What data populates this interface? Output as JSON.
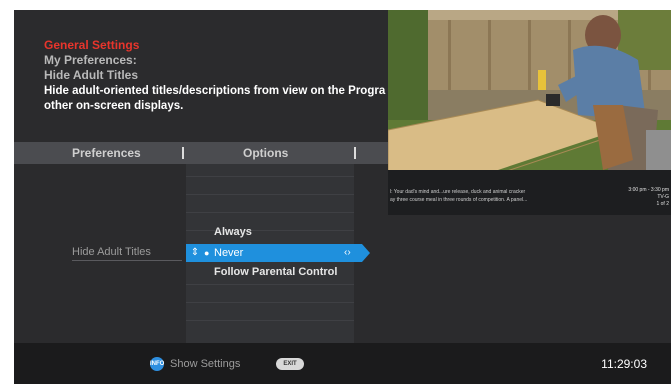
{
  "header": {
    "title": "General Settings",
    "breadcrumb_1": "My Preferences:",
    "breadcrumb_2": "Hide Adult Titles",
    "description_line1": "Hide adult-oriented titles/descriptions from view on the Progra",
    "description_line2": "other on-screen displays."
  },
  "columns": {
    "preferences": "Preferences",
    "options": "Options"
  },
  "setting": {
    "label": "Hide Adult Titles"
  },
  "options": [
    {
      "label": "Always"
    },
    {
      "label": "Never",
      "selected": true
    },
    {
      "label": "Follow Parental Control"
    }
  ],
  "preview": {
    "description_line1": "l: Your dad's mind and...ure release, duck and animal cracker",
    "description_line2": "ay three course meal in three rounds of competition. A panel...",
    "time": "3:00 pm - 3:30 pm",
    "rating": "TV-G",
    "page": "1 of 2"
  },
  "footer": {
    "blue_button_label": "INFO",
    "show_settings": "Show Settings",
    "exit_label": "EXIT",
    "clock": "11:29:03"
  },
  "colors": {
    "accent_red": "#e8352c",
    "selection_blue": "#1f90dd",
    "background": "#2b2b2d"
  }
}
